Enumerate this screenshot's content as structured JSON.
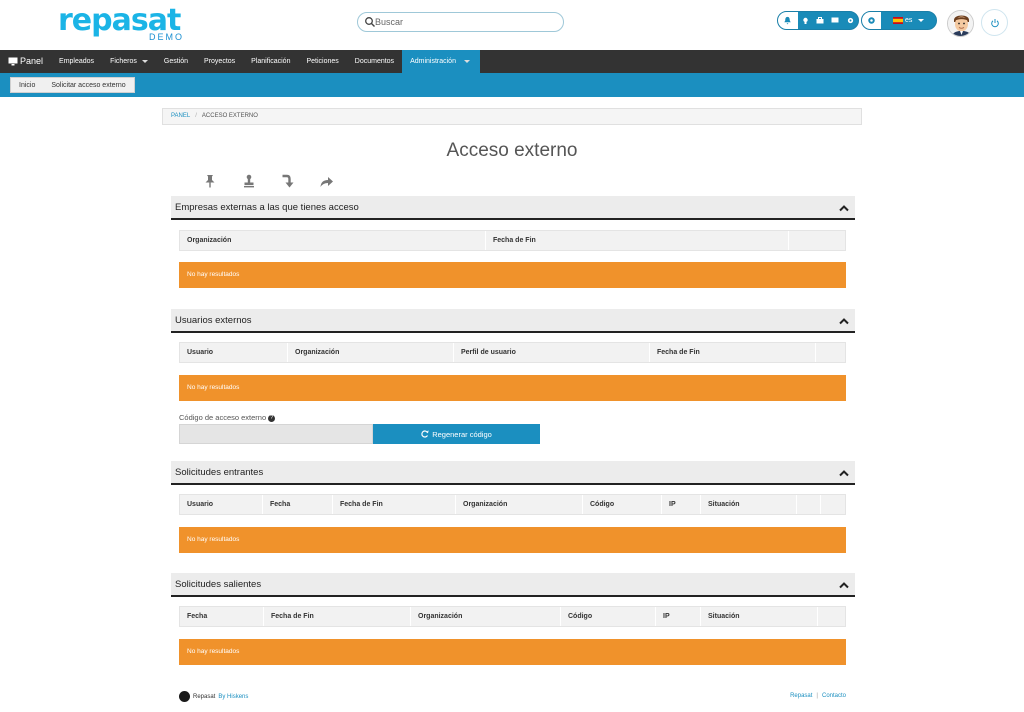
{
  "brand": {
    "name": "repasat",
    "edition": "DEMO"
  },
  "search": {
    "placeholder": "Buscar"
  },
  "header": {
    "language": "es"
  },
  "nav": {
    "panel": "Panel",
    "items": [
      "Empleados",
      "Ficheros",
      "Gestión",
      "Proyectos",
      "Planificación",
      "Peticiones",
      "Documentos",
      "Administración"
    ]
  },
  "subnav": {
    "items": [
      "Inicio",
      "Solicitar acceso externo"
    ]
  },
  "breadcrumb": {
    "root": "PANEL",
    "separator": "/",
    "current": "ACCESO EXTERNO"
  },
  "page": {
    "title": "Acceso externo"
  },
  "sections": {
    "empresas": {
      "title": "Empresas externas a las que tienes acceso",
      "columns": [
        "Organización",
        "Fecha de Fin",
        ""
      ],
      "empty": "No hay resultados"
    },
    "usuarios": {
      "title": "Usuarios externos",
      "columns": [
        "Usuario",
        "Organización",
        "Perfil de usuario",
        "Fecha de Fin",
        ""
      ],
      "empty": "No hay resultados"
    },
    "entrantes": {
      "title": "Solicitudes entrantes",
      "columns": [
        "Usuario",
        "Fecha",
        "Fecha de Fin",
        "Organización",
        "Código",
        "IP",
        "Situación",
        "",
        ""
      ],
      "empty": "No hay resultados"
    },
    "salientes": {
      "title": "Solicitudes salientes",
      "columns": [
        "Fecha",
        "Fecha de Fin",
        "Organización",
        "Código",
        "IP",
        "Situación",
        ""
      ],
      "empty": "No hay resultados"
    }
  },
  "code": {
    "label": "Código de acceso externo",
    "value": "",
    "regenerate": "Regenerar código"
  },
  "footer": {
    "brand": "Repasat",
    "by": "By Hiskens",
    "links": [
      "Repasat",
      "Contacto"
    ]
  },
  "colors": {
    "accent": "#1b8fc0",
    "empty": "#f0922b",
    "navbar": "#333333"
  },
  "icons": {
    "toolbar": [
      "pin-icon",
      "stamp-icon",
      "arrow-down-turn-icon",
      "share-icon"
    ],
    "header": [
      "bell-icon",
      "lightbulb-icon",
      "briefcase-icon",
      "message-icon",
      "gear-icon",
      "spain-flag-icon",
      "power-icon"
    ]
  }
}
